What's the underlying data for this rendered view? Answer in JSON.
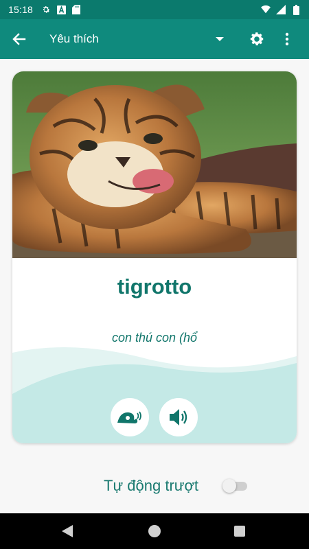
{
  "status_bar": {
    "time": "15:18",
    "icons": [
      "settings-gear-icon",
      "font-a-icon",
      "sd-card-icon",
      "wifi-icon",
      "signal-icon",
      "battery-icon"
    ]
  },
  "app_bar": {
    "title": "Yêu thích",
    "icons": [
      "arrow-back-icon",
      "dropdown-caret-icon",
      "settings-gear-icon",
      "more-vert-icon"
    ]
  },
  "card": {
    "image_subject": "tiger cub",
    "word": "tigrotto",
    "meaning": "con thú con (hổ",
    "buttons": [
      "slow-audio-snail-icon",
      "volume-speaker-icon"
    ]
  },
  "auto_slide": {
    "label": "Tự động trượt",
    "enabled": false
  },
  "colors": {
    "status_bar": "#0b7a6d",
    "app_bar": "#0f8a7d",
    "accent_text": "#11766b",
    "wave": "#c4e9e6",
    "background": "#f7f7f7"
  }
}
